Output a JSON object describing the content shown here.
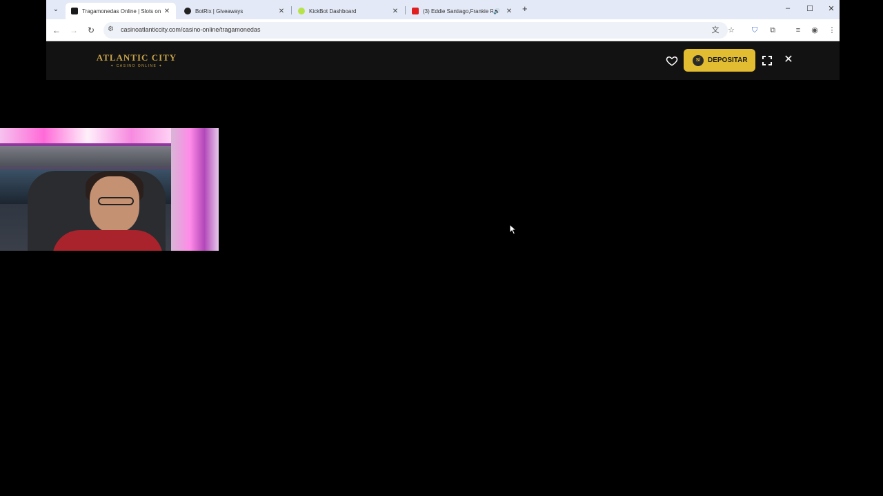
{
  "tabs": [
    {
      "title": "Tragamonedas Online | Slots on",
      "active": true,
      "favicon_color": "#1a1a1a"
    },
    {
      "title": "BotRix | Giveaways",
      "active": false,
      "favicon_color": "#222222"
    },
    {
      "title": "KickBot Dashboard",
      "active": false,
      "favicon_color": "#b6e34a"
    },
    {
      "title": "(3) Eddie Santiago,Frankie R",
      "active": false,
      "favicon_color": "#e02020"
    }
  ],
  "address_bar": {
    "url": "casinoatlanticcity.com/casino-online/tragamonedas"
  },
  "site": {
    "logo_line1": "ATLANTIC CITY",
    "logo_line2": "✦ CASINO ONLINE ✦",
    "deposit_label": "DEPOSITAR",
    "deposit_coin": "S/",
    "accent_color": "#e3bd31"
  }
}
